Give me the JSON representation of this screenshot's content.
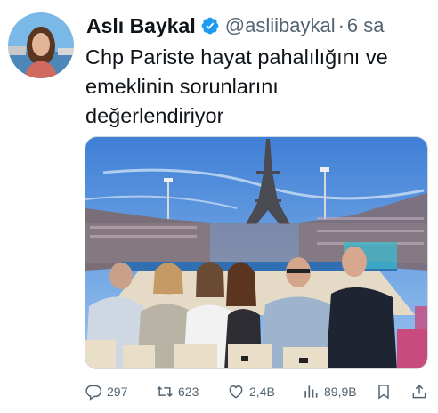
{
  "tweet": {
    "display_name": "Aslı Baykal",
    "handle": "@asliibaykal",
    "separator": "·",
    "time": "6 sa",
    "text_lines": [
      "Chp Pariste hayat pahalılığını ve",
      "emeklinin sorunlarını",
      "değerlendiriyor"
    ]
  },
  "actions": {
    "replies": "297",
    "retweets": "623",
    "likes": "2,4B",
    "views": "89,9B"
  },
  "colors": {
    "verified": "#1d9bf0",
    "muted": "#536471",
    "text": "#0f1419"
  },
  "icons": [
    "verified-badge-icon",
    "reply-icon",
    "retweet-icon",
    "like-icon",
    "views-icon",
    "bookmark-icon",
    "share-icon"
  ]
}
